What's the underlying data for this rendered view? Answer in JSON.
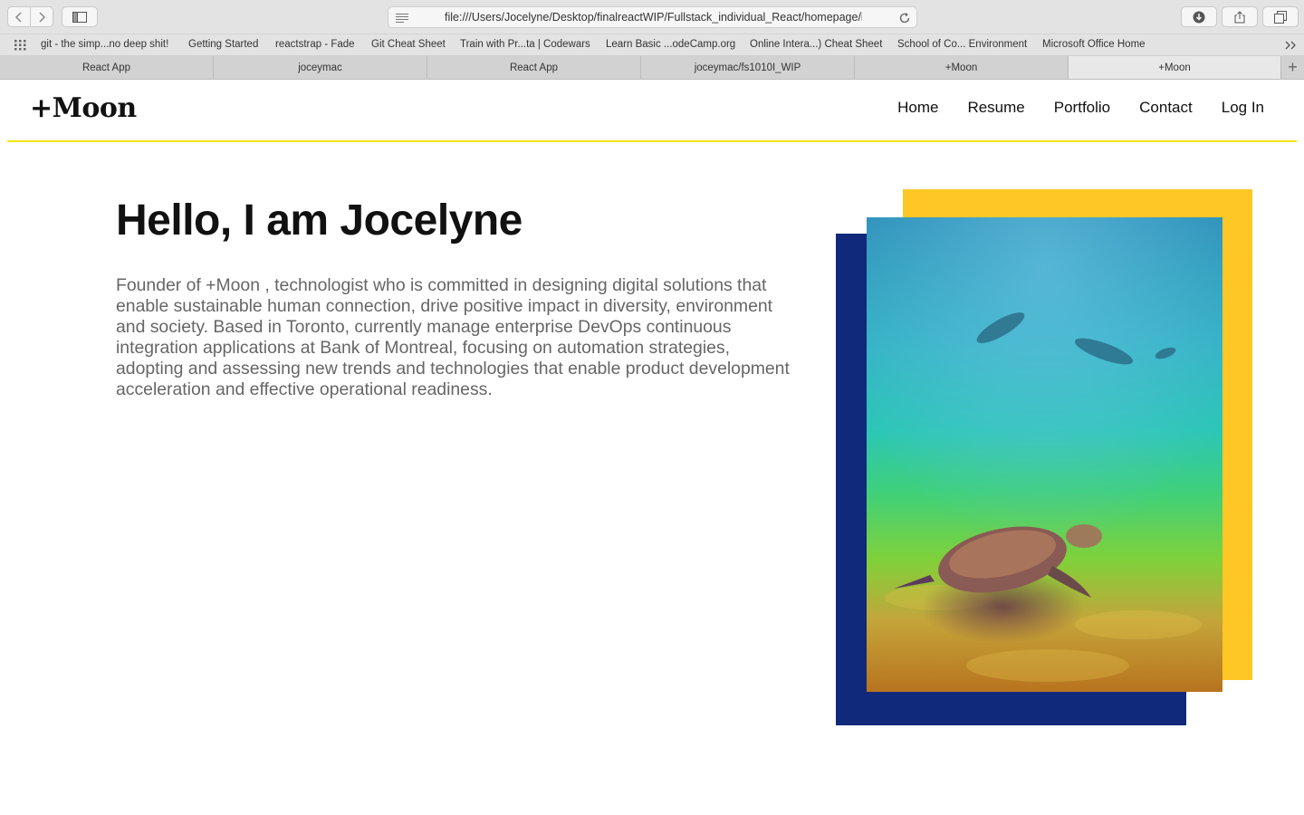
{
  "browser": {
    "url": "file:///Users/Jocelyne/Desktop/finalreactWIP/Fullstack_individual_React/homepage/index.html",
    "bookmarks": [
      "git - the simp...no deep shit!",
      "Getting Started",
      "reactstrap - Fade",
      "Git Cheat Sheet",
      "Train with Pr...ta | Codewars",
      "Learn Basic ...odeCamp.org",
      "Online Intera...) Cheat Sheet",
      "School of Co... Environment",
      "Microsoft Office Home"
    ],
    "tabs": [
      "React App",
      "joceymac",
      "React App",
      "joceymac/fs1010I_WIP",
      "+Moon",
      "+Moon"
    ]
  },
  "site": {
    "logo": "+Moon",
    "nav": [
      "Home",
      "Resume",
      "Portfolio",
      "Contact",
      "Log In"
    ]
  },
  "hero": {
    "title": "Hello, I am Jocelyne",
    "description": "Founder of +Moon , technologist who is committed in designing digital solutions that enable sustainable human connection, drive positive impact in diversity, environment and society. Based in Toronto, currently manage enterprise DevOps continuous integration applications at Bank of Montreal, focusing on automation strategies, adopting and assessing new trends and technologies that enable product development acceleration and effective operational readiness."
  },
  "colors": {
    "accent_yellow": "#ffc726",
    "accent_blue": "#11297a",
    "rule_yellow": "#f2e600"
  },
  "icons": [
    "back-icon",
    "forward-icon",
    "sidebar-icon",
    "reader-icon",
    "reload-icon",
    "download-icon",
    "share-icon",
    "tabs-icon",
    "grid-icon",
    "overflow-icon",
    "new-tab-icon"
  ]
}
